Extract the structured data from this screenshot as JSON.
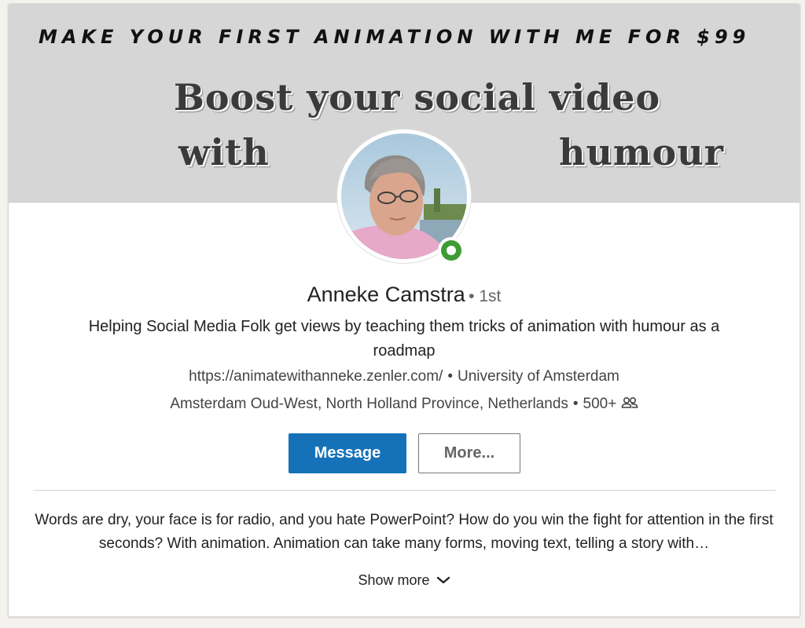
{
  "banner": {
    "top_text": "MAKE YOUR FIRST ANIMATION WITH ME FOR $99",
    "line1": "Boost your social video",
    "line2_left": "with",
    "line2_right": "humour"
  },
  "profile": {
    "name": "Anneke Camstra",
    "degree": "• 1st",
    "headline": "Helping Social Media Folk get views by teaching them tricks of animation with humour as a roadmap",
    "website": "https://animatewithanneke.zenler.com/",
    "school": "University of Amsterdam",
    "location": "Amsterdam Oud-West, North Holland Province, Netherlands",
    "connections": "500+",
    "separator": "•",
    "presence": "online",
    "presence_color": "#3f9c35"
  },
  "actions": {
    "message_label": "Message",
    "more_label": "More..."
  },
  "summary": {
    "text": "Words are dry, your face is for radio, and you hate PowerPoint? How do you win the fight for attention in the first seconds? With animation. Animation can take many forms, moving text, telling a story with…",
    "show_more_label": "Show more"
  },
  "colors": {
    "accent": "#1672b8",
    "banner_bg": "#d6d6d6"
  },
  "icons": {
    "connections": "connections-icon",
    "show_more": "chevron-down-icon"
  }
}
